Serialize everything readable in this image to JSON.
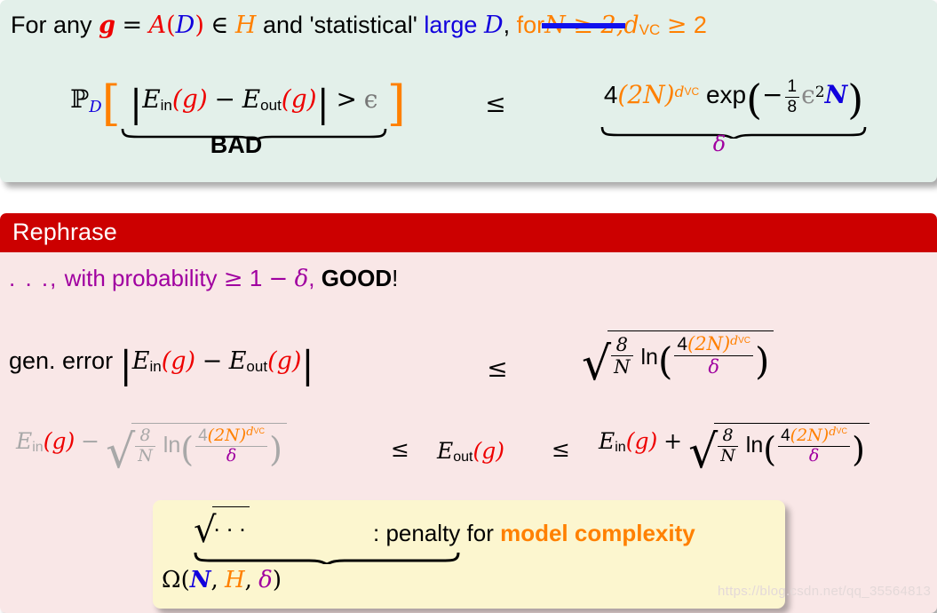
{
  "slide": {
    "top_panel": {
      "statement": {
        "prefix": "For any",
        "g": "g",
        "equals": "=",
        "algorithm": "A",
        "open_paren": "(",
        "dataset": "D",
        "close_paren": ")",
        "in_symbol": "∈",
        "hypothesis_set": "H",
        "and_text": "and 'statistical'",
        "large_word": "large",
        "dataset2": "D",
        "comma": ",",
        "for_word": "for",
        "struck_text": "N ≥ 2,",
        "dvc": "d",
        "dvc_sub": "VC",
        "geq": "≥",
        "two": "2"
      },
      "inequality": {
        "lhs": {
          "prob_symbol": "ℙ",
          "prob_sub": "D",
          "open_bracket": "[",
          "abs_open": "|",
          "E_in": "E",
          "E_in_sub": "in",
          "arg_g": "(g)",
          "minus": "−",
          "E_out": "E",
          "E_out_sub": "out",
          "abs_close": "|",
          "greater": ">",
          "epsilon": "ϵ",
          "close_bracket": "]",
          "underbrace_label": "BAD"
        },
        "relation": "≤",
        "rhs": {
          "four": "4",
          "two_N": "(2N)",
          "exponent_d": "d",
          "exponent_sub": "VC",
          "exp_fn": "exp",
          "open_paren": "(",
          "minus": "−",
          "frac_num": "1",
          "frac_den": "8",
          "epsilon": "ϵ",
          "epsilon_sup": "2",
          "N": "N",
          "close_paren": ")",
          "underbrace_label": "δ"
        }
      }
    },
    "bottom_panel": {
      "header_label": "Rephrase",
      "probability_line": {
        "dots": ". . .,",
        "text": "with probability",
        "geq": "≥",
        "one": "1",
        "minus": "−",
        "delta": "δ",
        "comma": ",",
        "good": "GOOD",
        "bang": "!"
      },
      "gen_error_row": {
        "label": "gen. error",
        "abs_open": "|",
        "E_in": "E",
        "E_in_sub": "in",
        "arg_g": "(g)",
        "minus": "−",
        "E_out": "E",
        "E_out_sub": "out",
        "abs_close": "|",
        "relation": "≤",
        "sqrt": {
          "frac_num": "8",
          "frac_den": "N",
          "ln": "ln",
          "open_paren": "(",
          "inner_num_4": "4",
          "inner_num_2N": "(2N)",
          "inner_exp_d": "d",
          "inner_exp_sub": "VC",
          "inner_den": "δ",
          "close_paren": ")"
        }
      },
      "sandwich_row": {
        "left_E_in": "E",
        "left_E_in_sub": "in",
        "left_arg": "(g)",
        "left_minus": "−",
        "relation1": "≤",
        "middle_E_out": "E",
        "middle_E_out_sub": "out",
        "middle_arg": "(g)",
        "relation2": "≤",
        "right_E_in": "E",
        "right_E_in_sub": "in",
        "right_arg": "(g)",
        "right_plus": "+",
        "sqrt": {
          "frac_num": "8",
          "frac_den": "N",
          "ln": "ln",
          "open_paren": "(",
          "inner_num_4": "4",
          "inner_num_2N": "(2N)",
          "inner_exp_d": "d",
          "inner_exp_sub": "VC",
          "inner_den": "δ",
          "close_paren": ")"
        }
      },
      "callout": {
        "sqrt_symbol": "√",
        "sqrt_dots": ". . .",
        "colon_text": ": penalty for",
        "highlight": "model complexity",
        "omega": "Ω",
        "omega_open": "(",
        "omega_N": "N",
        "omega_comma1": ",",
        "omega_H": "H",
        "omega_comma2": ",",
        "omega_delta": "δ",
        "omega_close": ")"
      }
    },
    "watermark": "https://blog.csdn.net/qq_35564813"
  },
  "colors": {
    "panel_green": "#e3f0ea",
    "panel_pink": "#f9e7e7",
    "header_red": "#cc0000",
    "callout_yellow": "#fcf6cf",
    "accent_red": "#ee0000",
    "accent_orange": "#ff8000",
    "accent_blue": "#1100dd",
    "accent_purple": "#a000a0",
    "muted_grey": "#a8a8a8"
  }
}
